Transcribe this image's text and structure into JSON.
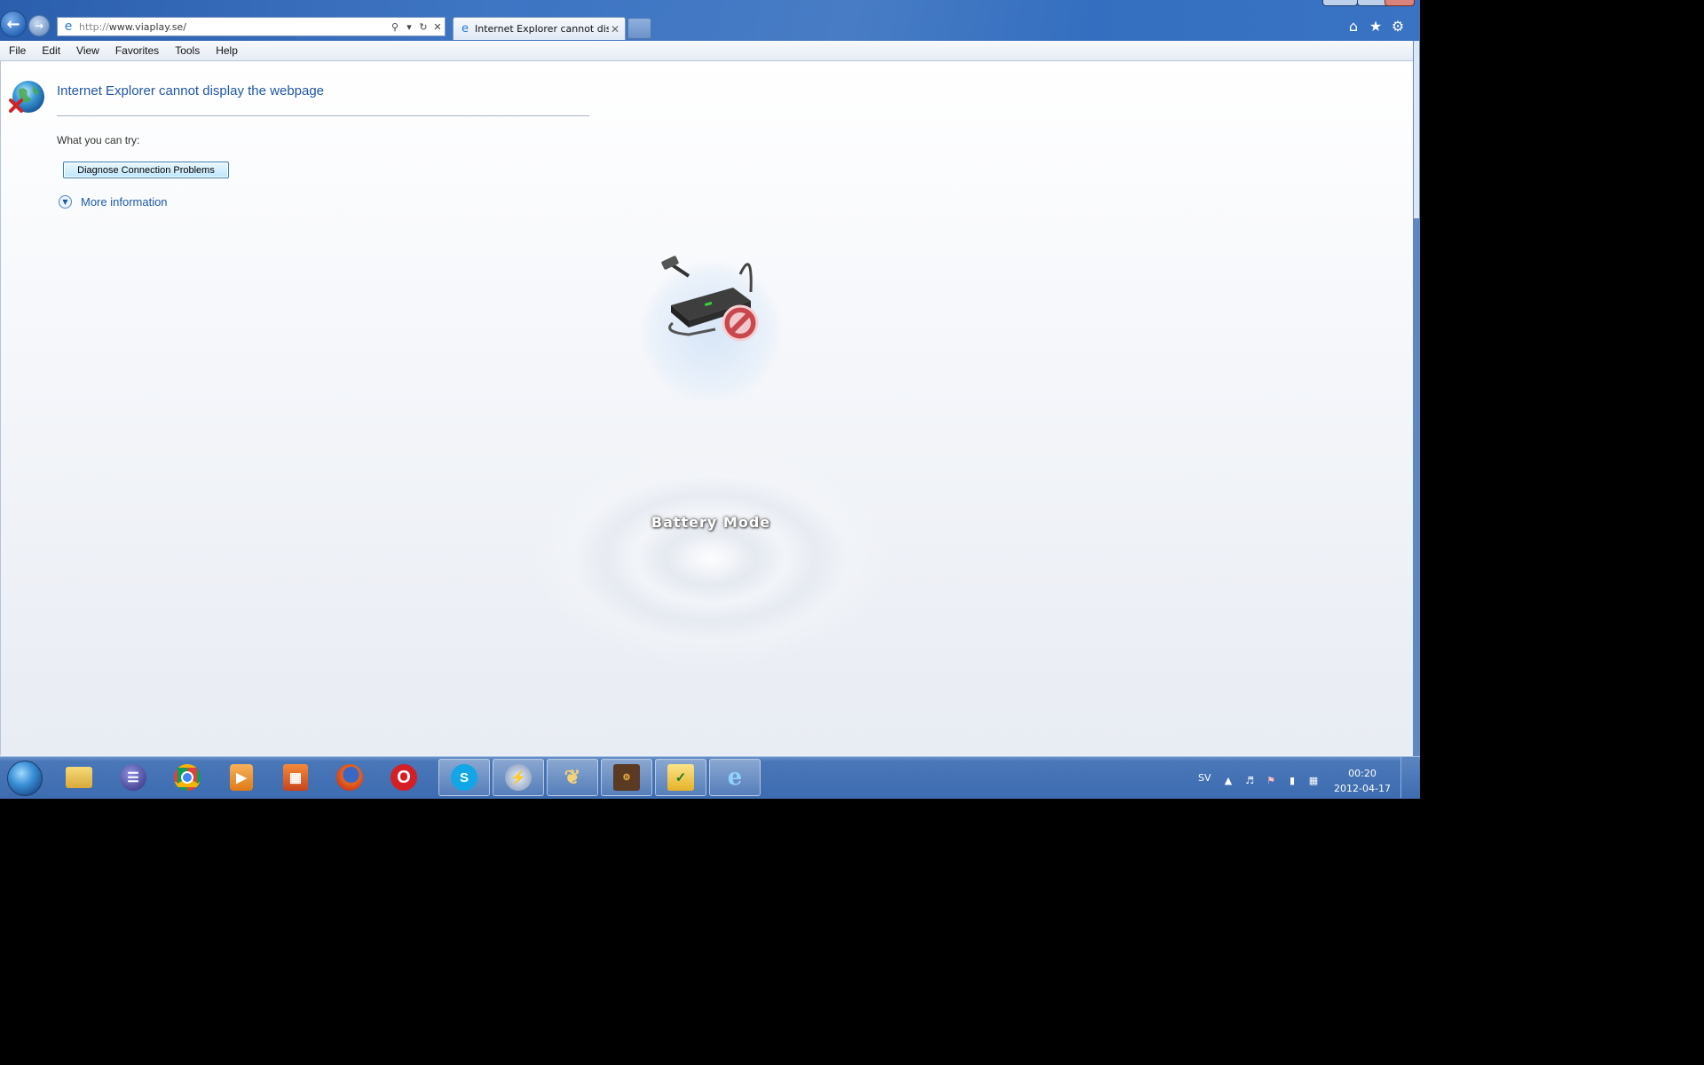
{
  "browser": {
    "address": {
      "protocol": "http://",
      "host": "www.viaplay.se/"
    },
    "tab": {
      "title": "Internet Explorer cannot dis...",
      "close_glyph": "✕"
    },
    "toolbar_icons": [
      "home-icon",
      "favorites-star-icon",
      "tools-gear-icon"
    ]
  },
  "menubar": {
    "items": [
      "File",
      "Edit",
      "View",
      "Favorites",
      "Tools",
      "Help"
    ]
  },
  "error_page": {
    "title": "Internet Explorer cannot display the webpage",
    "try_label": "What you can try:",
    "diagnose_button": "Diagnose Connection Problems",
    "more_info": "More information"
  },
  "overlay": {
    "battery_mode": "Battery Mode"
  },
  "taskbar": {
    "apps": [
      "windows-explorer-icon",
      "eclipse-icon",
      "chrome-icon",
      "media-player-icon",
      "office-icon",
      "firefox-icon",
      "opera-icon",
      "skype-icon",
      "system-tool-icon",
      "feather-app-icon",
      "ide-app-icon",
      "mail-app-icon",
      "internet-explorer-icon"
    ],
    "active_apps": [
      "skype-icon",
      "system-tool-icon",
      "feather-app-icon",
      "ide-app-icon",
      "mail-app-icon",
      "internet-explorer-icon"
    ],
    "tray": {
      "language": "SV",
      "time": "00:20",
      "date": "2012-04-17"
    }
  },
  "colors": {
    "link_blue": "#1f58a6",
    "taskbar": "#3c6bb0",
    "title_bar": "#2f6bbd"
  }
}
